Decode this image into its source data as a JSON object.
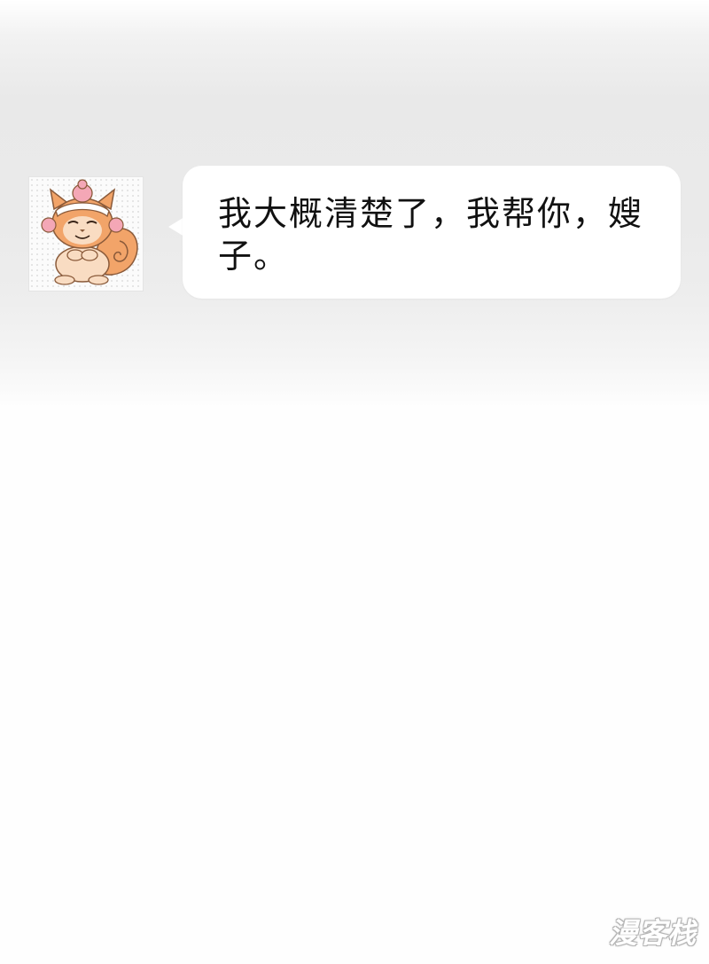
{
  "chat": {
    "avatar": {
      "icon": "cartoon-squirrel-avatar",
      "colors": {
        "fur": "#f2a469",
        "fur_light": "#f9dcc2",
        "hair_bun": "#f4a7b6",
        "headband": "#ffffff",
        "outline": "#8a5a3a"
      }
    },
    "message": {
      "text": "我大概清楚了，我帮你，嫂子。",
      "bubble_color": "#ffffff",
      "text_color": "#111111"
    }
  },
  "watermark": {
    "text": "漫客栈"
  }
}
